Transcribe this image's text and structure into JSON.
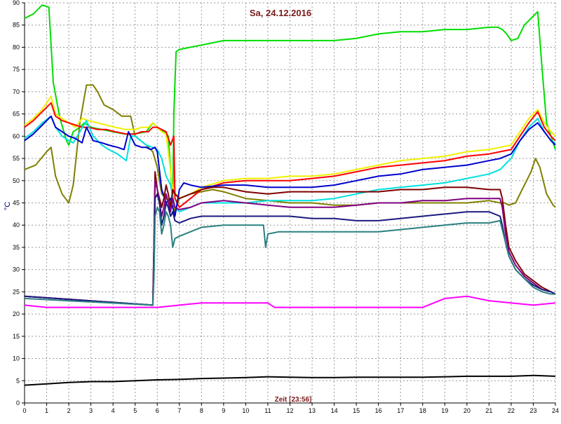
{
  "chart_data": {
    "type": "line",
    "title": "Sa, 24.12.2016",
    "xlabel": "Zeit [23:56]",
    "ylabel": "°C",
    "xlim": [
      0,
      24
    ],
    "ylim": [
      0,
      90
    ],
    "xticks": [
      0,
      1,
      2,
      3,
      4,
      5,
      6,
      7,
      8,
      9,
      10,
      11,
      12,
      13,
      14,
      15,
      16,
      17,
      18,
      19,
      20,
      21,
      22,
      23,
      24
    ],
    "yticks": [
      0,
      5,
      10,
      15,
      20,
      25,
      30,
      35,
      40,
      45,
      50,
      55,
      60,
      65,
      70,
      75,
      80,
      85,
      90
    ],
    "grid": true,
    "legend": "none",
    "colors": {
      "title": "#7a1a1a",
      "xlabel": "#7a1a1a",
      "ylabel": "#000080",
      "background": "#ffffff",
      "grid": "#9a9a9a"
    },
    "series": [
      {
        "color": "#00dd00",
        "x": [
          0,
          0.4,
          0.8,
          1.1,
          1.3,
          1.6,
          1.9,
          2.0,
          2.2,
          2.5,
          2.7,
          3.0,
          3.5,
          4.0,
          4.5,
          5.0,
          5.5,
          5.8,
          6.0,
          6.3,
          6.5,
          6.7,
          6.75,
          6.85,
          7.0,
          7.5,
          8.0,
          8.5,
          9.0,
          10,
          11,
          12,
          13,
          14,
          15,
          16,
          17,
          18,
          19,
          20,
          21,
          21.4,
          21.6,
          21.8,
          22.0,
          22.3,
          22.6,
          23.0,
          23.2,
          23.4,
          23.6,
          23.8,
          24
        ],
        "y": [
          86.5,
          87.5,
          89.5,
          89,
          72,
          64,
          59,
          58,
          61,
          62,
          63,
          62,
          61.5,
          61,
          60.5,
          60.5,
          61,
          63,
          62,
          61,
          60,
          45,
          65,
          79,
          79.5,
          80,
          80.5,
          81,
          81.5,
          81.5,
          81.5,
          81.5,
          81.5,
          81.5,
          82,
          83,
          83.5,
          83.5,
          84,
          84,
          84.5,
          84.5,
          84,
          83,
          81.5,
          82,
          85,
          87,
          88,
          75,
          63,
          60,
          57
        ]
      },
      {
        "color": "#808000",
        "x": [
          0,
          0.5,
          1.0,
          1.2,
          1.4,
          1.7,
          2.0,
          2.2,
          2.5,
          2.8,
          3.1,
          3.3,
          3.6,
          4.0,
          4.4,
          4.8,
          5.0,
          5.5,
          5.8,
          6.0,
          6.2,
          6.5,
          6.7,
          6.8,
          7.0,
          7.5,
          8.0,
          8.5,
          9.0,
          10,
          11,
          12,
          13,
          14,
          15,
          16,
          17,
          18,
          19,
          20,
          21,
          21.5,
          21.7,
          21.9,
          22.2,
          22.6,
          22.9,
          23.1,
          23.3,
          23.6,
          23.9,
          24
        ],
        "y": [
          52.5,
          53.5,
          56.5,
          57.5,
          51,
          47,
          45,
          49,
          63,
          71.5,
          71.5,
          70,
          67,
          66,
          64.5,
          64.5,
          60,
          58,
          56.5,
          53,
          47,
          45.5,
          46,
          43,
          46,
          47,
          47.5,
          48,
          47.5,
          46,
          45.5,
          45,
          45,
          44.5,
          44.5,
          45,
          45,
          45,
          45,
          45,
          45.5,
          45,
          45,
          44.5,
          45,
          49,
          52,
          55,
          53,
          47,
          44.5,
          44
        ]
      },
      {
        "color": "#f0f000",
        "x": [
          0,
          0.4,
          0.8,
          1.2,
          1.4,
          1.7,
          2.0,
          2.3,
          2.6,
          2.9,
          3.3,
          3.7,
          4.1,
          4.6,
          5.0,
          5.3,
          5.6,
          5.8,
          6.0,
          6.2,
          6.4,
          6.7,
          7.0,
          7.5,
          8.0,
          9.0,
          10,
          11,
          12,
          13,
          14,
          15,
          16,
          17,
          18,
          19,
          20,
          21,
          21.5,
          22.0,
          22.4,
          22.8,
          23.2,
          23.5,
          23.8,
          24
        ],
        "y": [
          62.5,
          64,
          66,
          69,
          65,
          64,
          63,
          62,
          64,
          63.5,
          63,
          62.5,
          62,
          61.5,
          61.5,
          62,
          62,
          63,
          62,
          61,
          60.5,
          48,
          46,
          47,
          48.5,
          50,
          50.5,
          50.5,
          51,
          51,
          51.5,
          52.5,
          53.5,
          54.5,
          55,
          55.5,
          56.5,
          57,
          57.5,
          58,
          61,
          64,
          66,
          63,
          61,
          60
        ]
      },
      {
        "color": "#ff0000",
        "x": [
          0,
          0.4,
          0.8,
          1.2,
          1.4,
          1.7,
          2.0,
          2.3,
          2.6,
          2.9,
          3.3,
          3.7,
          4.1,
          4.6,
          5.0,
          5.3,
          5.6,
          5.8,
          6.0,
          6.2,
          6.4,
          6.6,
          6.75,
          6.8,
          7.0,
          7.5,
          8.0,
          9.0,
          10,
          11,
          12,
          13,
          14,
          15,
          16,
          17,
          18,
          19,
          20,
          21,
          21.5,
          22.0,
          22.4,
          22.8,
          23.2,
          23.5,
          23.8,
          24
        ],
        "y": [
          62,
          63.5,
          65.5,
          67.5,
          64.5,
          63.5,
          63,
          62.5,
          62,
          62,
          61.5,
          61.5,
          61,
          60.5,
          60.5,
          61,
          61,
          62,
          62,
          61.5,
          61,
          58,
          60,
          46,
          44,
          46,
          48,
          49.5,
          50,
          50,
          50,
          50.5,
          51,
          52,
          53,
          53.5,
          54,
          54.5,
          55.5,
          56,
          56.5,
          57,
          60,
          63,
          65.5,
          62,
          60,
          59
        ]
      },
      {
        "color": "#00e0e0",
        "x": [
          0,
          0.4,
          0.8,
          1.2,
          1.4,
          1.7,
          2.0,
          2.2,
          2.5,
          2.8,
          3.1,
          3.5,
          3.8,
          4.2,
          4.6,
          4.8,
          5.0,
          5.5,
          5.8,
          6.0,
          6.2,
          6.4,
          6.6,
          6.8,
          7.0,
          7.5,
          8.0,
          9.0,
          10,
          11,
          12,
          13,
          14,
          15,
          16,
          17,
          18,
          19,
          20,
          21,
          21.5,
          22.0,
          22.4,
          22.8,
          23.2,
          23.5,
          23.8,
          24
        ],
        "y": [
          59.5,
          61,
          63,
          64.5,
          62,
          60,
          59,
          58.5,
          61,
          63.5,
          60,
          58,
          57,
          56,
          54.5,
          60,
          60,
          58,
          57.5,
          57,
          55,
          51,
          49,
          44,
          43,
          44,
          45,
          45,
          45,
          45.5,
          45.5,
          45.5,
          46,
          47,
          48,
          48.5,
          49,
          49.5,
          50.5,
          51.5,
          52.5,
          55,
          59,
          62,
          64,
          61,
          59,
          58.5
        ]
      },
      {
        "color": "#0000cd",
        "x": [
          0,
          0.4,
          0.8,
          1.2,
          1.4,
          1.7,
          2.0,
          2.3,
          2.6,
          2.8,
          3.1,
          3.5,
          3.8,
          4.2,
          4.5,
          4.7,
          5.0,
          5.3,
          5.5,
          5.7,
          5.9,
          6.0,
          6.2,
          6.4,
          6.6,
          6.8,
          7.0,
          7.2,
          7.5,
          8.0,
          9.0,
          10,
          11,
          12,
          13,
          14,
          15,
          16,
          17,
          18,
          19,
          20,
          21,
          21.5,
          22.0,
          22.4,
          22.8,
          23.2,
          23.5,
          23.8,
          24
        ],
        "y": [
          59,
          60.5,
          62.5,
          64.5,
          62,
          61,
          60,
          59.5,
          58.5,
          62,
          59,
          58.5,
          58,
          57.5,
          57,
          61,
          58,
          57.5,
          57.5,
          57,
          57.5,
          56.5,
          48,
          45,
          46,
          42,
          48,
          49.5,
          49,
          48.5,
          49,
          49,
          48.5,
          48.5,
          48.5,
          49,
          50,
          51,
          51.5,
          52.5,
          53,
          53.5,
          54.5,
          55,
          56,
          59,
          61.5,
          63,
          61,
          59,
          58
        ]
      },
      {
        "color": "#800000",
        "x": [
          0,
          5.8,
          5.85,
          5.9,
          6.0,
          6.1,
          6.2,
          6.3,
          6.4,
          6.5,
          6.6,
          6.7,
          6.8,
          7.0,
          7.5,
          8.0,
          8.5,
          9.0,
          10,
          11,
          12,
          13,
          14,
          15,
          16,
          17,
          18,
          19,
          20,
          21,
          21.5,
          21.6,
          21.75,
          21.9,
          22.2,
          22.6,
          23.0,
          23.4,
          23.8,
          24
        ],
        "y": [
          24,
          22,
          35,
          52,
          48,
          46,
          44,
          46,
          49,
          47,
          44,
          48,
          47,
          46,
          47,
          48,
          48.5,
          48.5,
          47.5,
          47,
          47.5,
          47.5,
          47.5,
          47.5,
          47.5,
          48,
          48,
          48.5,
          48.5,
          48,
          48,
          46,
          40,
          35,
          32,
          29,
          27.5,
          26,
          25,
          24.5
        ]
      },
      {
        "color": "#800080",
        "x": [
          0,
          5.8,
          5.85,
          5.9,
          6.0,
          6.1,
          6.2,
          6.3,
          6.4,
          6.5,
          6.6,
          6.7,
          6.8,
          7.0,
          7.5,
          8.0,
          9.0,
          10,
          11,
          12,
          13,
          14,
          15,
          16,
          17,
          18,
          19,
          20,
          21,
          21.5,
          21.6,
          21.75,
          21.9,
          22.2,
          22.6,
          23.0,
          23.4,
          23.8,
          24
        ],
        "y": [
          24,
          22,
          35,
          50,
          48,
          45,
          42,
          44,
          47,
          45,
          43,
          46,
          44,
          43.5,
          44,
          45,
          45.5,
          45,
          44.5,
          44,
          44,
          44,
          44.5,
          45,
          45,
          45.5,
          45.5,
          46,
          46,
          46,
          44,
          38,
          34,
          31,
          28.5,
          27,
          25.5,
          25,
          24.5
        ]
      },
      {
        "color": "#1a1a80",
        "x": [
          0,
          5.8,
          5.85,
          5.9,
          6.0,
          6.1,
          6.2,
          6.3,
          6.4,
          6.5,
          6.6,
          6.7,
          6.8,
          7.0,
          7.5,
          8.0,
          9.0,
          10,
          11,
          12,
          13,
          14,
          15,
          16,
          17,
          18,
          19,
          20,
          21,
          21.5,
          21.6,
          21.75,
          21.9,
          22.2,
          22.6,
          23.0,
          23.4,
          23.8,
          24
        ],
        "y": [
          24,
          22,
          30,
          46,
          47,
          45,
          40,
          42,
          45,
          44,
          42,
          43,
          41,
          40.5,
          41.5,
          42,
          42,
          42,
          42,
          42,
          41.5,
          41.5,
          41,
          41,
          41.5,
          42,
          42.5,
          43,
          43,
          42,
          40,
          36,
          33,
          30,
          28,
          26.5,
          25.5,
          25,
          24.5
        ]
      },
      {
        "color": "#2a8080",
        "x": [
          0,
          5.8,
          5.85,
          5.9,
          6.0,
          6.1,
          6.2,
          6.3,
          6.4,
          6.5,
          6.6,
          6.7,
          6.8,
          7.0,
          7.5,
          8.0,
          9.0,
          10,
          10.8,
          10.9,
          11.0,
          11.5,
          12,
          13,
          14,
          15,
          16,
          17,
          18,
          19,
          20,
          21,
          21.5,
          21.6,
          21.75,
          21.9,
          22.2,
          22.6,
          23.0,
          23.4,
          23.8,
          24
        ],
        "y": [
          23.5,
          22,
          28,
          42,
          44,
          43,
          38,
          40,
          43,
          42,
          40,
          35,
          37,
          37.5,
          38.5,
          39.5,
          40,
          40,
          40,
          35,
          38,
          38.5,
          38.5,
          38.5,
          38.5,
          38.5,
          38.5,
          39,
          39.5,
          40,
          40.5,
          40.5,
          41,
          39,
          36,
          33,
          30,
          28,
          26,
          25,
          24.5,
          24.5
        ]
      },
      {
        "color": "#ff00ff",
        "x": [
          0,
          1,
          2,
          3,
          4,
          5,
          6,
          7,
          8,
          9,
          10,
          11,
          11.3,
          12,
          13,
          14,
          15,
          16,
          17,
          18,
          18.5,
          19,
          20,
          21,
          22,
          23,
          24
        ],
        "y": [
          22,
          21.5,
          21.5,
          21.5,
          21.5,
          21.5,
          21.5,
          22,
          22.5,
          22.5,
          22.5,
          22.5,
          21.5,
          21.5,
          21.5,
          21.5,
          21.5,
          21.5,
          21.5,
          21.5,
          22.5,
          23.5,
          24,
          23,
          22.5,
          22,
          22.5
        ]
      },
      {
        "color": "#000000",
        "x": [
          0,
          1,
          2,
          3,
          4,
          5,
          6,
          7,
          8,
          9,
          10,
          11,
          12,
          13,
          14,
          15,
          16,
          17,
          18,
          19,
          20,
          21,
          22,
          23,
          24
        ],
        "y": [
          4,
          4.3,
          4.6,
          4.8,
          4.8,
          5,
          5.2,
          5.3,
          5.5,
          5.6,
          5.7,
          5.9,
          5.8,
          5.7,
          5.7,
          5.8,
          5.8,
          5.8,
          5.8,
          5.9,
          6,
          6,
          6,
          6.2,
          6
        ]
      }
    ]
  }
}
